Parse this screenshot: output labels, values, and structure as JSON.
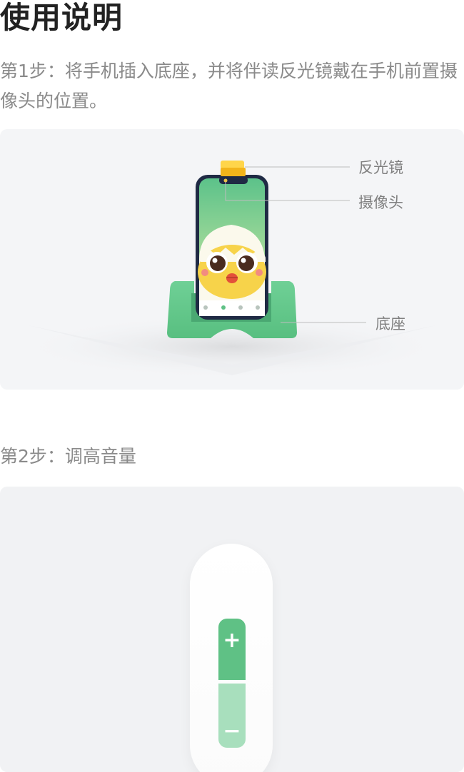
{
  "page": {
    "title": "使用说明"
  },
  "steps": [
    {
      "text": "第1步：将手机插入底座，并将伴读反光镜戴在手机前置摄像头的位置。",
      "callouts": {
        "mirror": "反光镜",
        "camera": "摄像头",
        "base": "底座"
      }
    },
    {
      "text": "第2步：调高音量",
      "volume": {
        "up_symbol": "+",
        "down_symbol": "−"
      }
    }
  ],
  "colors": {
    "accent": "#5fc185",
    "accent_light": "#a8dfbd",
    "mirror_yellow": "#f7c21e",
    "text_gray": "#8a8a8a"
  }
}
